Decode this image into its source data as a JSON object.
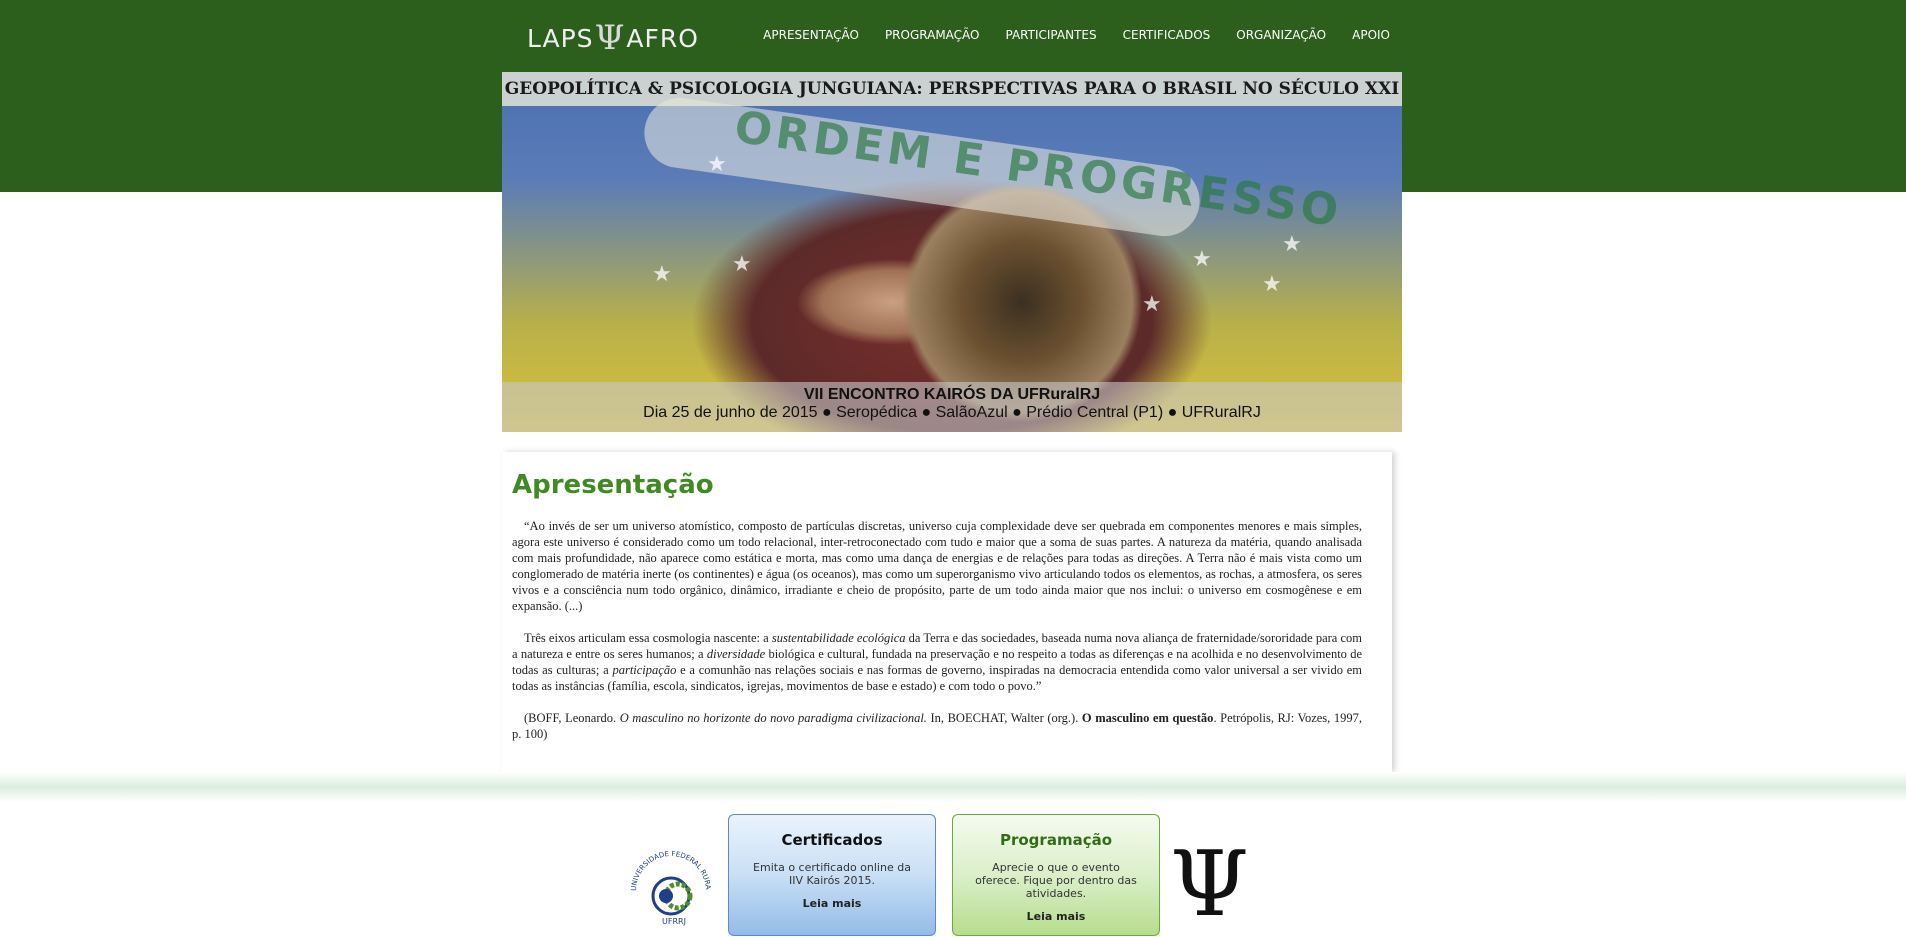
{
  "header": {
    "logo_left": "LAPS",
    "logo_psi": "Ψ",
    "logo_right": "AFRO",
    "nav": [
      "APRESENTAÇÃO",
      "PROGRAMAÇÃO",
      "PARTICIPANTES",
      "CERTIFICADOS",
      "ORGANIZAÇÃO",
      "APOIO"
    ],
    "band_color": "#2c5e1c"
  },
  "banner": {
    "title": "GEOPOLÍTICA & PSICOLOGIA JUNGUIANA: PERSPECTIVAS PARA O BRASIL NO SÉCULO XXI",
    "flag_text": "ORDEM E PROGRESSO",
    "caption_line1": "VII ENCONTRO KAIRÓS DA UFRuralRJ",
    "caption_line2": "Dia 25 de junho de 2015 ● Seropédica ● SalãoAzul ● Prédio Central (P1) ● UFRuralRJ"
  },
  "main": {
    "heading": "Apresentação",
    "p1": "“Ao invés de ser um universo atomístico, composto de partículas discretas, universo cuja complexidade deve ser quebrada em componentes menores e mais simples, agora este universo é considerado como um todo relacional, inter-retroconectado com tudo e maior que a soma de suas partes. A natureza da matéria, quando analisada com mais profundidade, não aparece como estática e morta, mas como uma dança de energias e de relações para todas as direções. A Terra não é mais vista como um conglomerado de matéria inerte (os continentes) e água (os oceanos), mas como um superorganismo vivo articulando todos os elementos, as rochas, a atmosfera, os seres vivos e a consciência num todo orgânico, dinâmico, irradiante e cheio de propósito, parte de um todo ainda maior que nos inclui: o universo em cosmogênese e em expansão. (...)",
    "p2_a": "Três eixos articulam essa cosmologia nascente: a ",
    "p2_em1": "sustentabilidade ecológica",
    "p2_b": " da Terra e das sociedades, baseada numa nova aliança de fraternidade/sororidade para com a natureza e entre os seres humanos; a ",
    "p2_em2": "diversidade",
    "p2_c": " biológica e cultural, fundada na preservação e no respeito a todas as diferenças e na acolhida e no desenvolvimento de todas as culturas; a ",
    "p2_em3": "participação",
    "p2_d": " e a comunhão nas relações sociais e nas formas de governo, inspiradas na democracia entendida como valor universal a ser vivido em todas as instâncias (família, escola, sindicatos, igrejas, movimentos de base e estado) e com todo o povo.”",
    "ref_a": "(BOFF, Leonardo. ",
    "ref_em": "O masculino no horizonte do novo paradigma civilizacional.",
    "ref_b": " In, BOECHAT, Walter (org.). ",
    "ref_strong": "O masculino em questão",
    "ref_c": ". Petrópolis, RJ: Vozes, 1997, p. 100)",
    "heading_color": "#3f8a22"
  },
  "footer": {
    "ufrrj_label": "UNIVERSIDADE FEDERAL RURAL DO RIO DE JANEIRO",
    "ufrrj_short": "UFRRJ",
    "box1": {
      "title": "Certificados",
      "desc": "Emita o certificado online da IIV Kairós 2015.",
      "more": "Leia mais"
    },
    "box2": {
      "title": "Programação",
      "desc": "Aprecie o que o evento oferece. Fique por dentro das atividades.",
      "more": "Leia mais"
    },
    "psi_symbol": "Ψ"
  }
}
